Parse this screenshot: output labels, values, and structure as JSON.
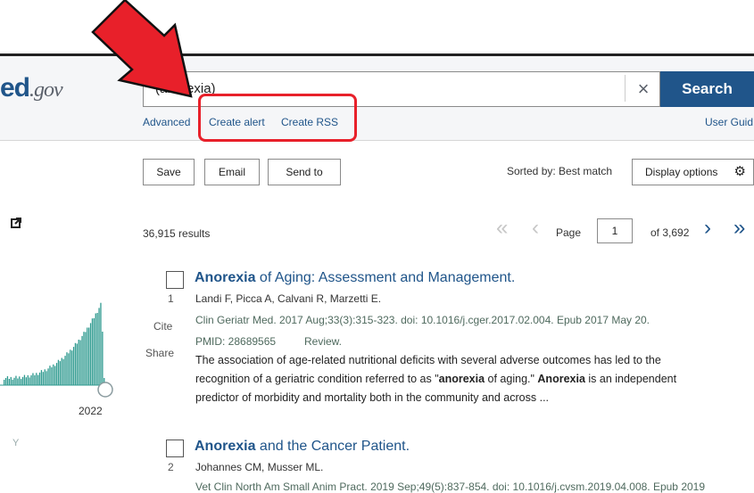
{
  "logo": {
    "text": "ed",
    "suffix": ".gov"
  },
  "search": {
    "value": "(anorexia)",
    "clear_icon": "×",
    "button_label": "Search"
  },
  "links": {
    "advanced": "Advanced",
    "create_alert": "Create alert",
    "create_rss": "Create RSS",
    "user_guide": "User Guid"
  },
  "toolbar": {
    "save": "Save",
    "email": "Email",
    "send_to": "Send to",
    "sorted_by": "Sorted by: Best match",
    "display_options": "Display options"
  },
  "results": {
    "count": "36,915 results"
  },
  "pagination": {
    "label": "Page",
    "current": "1",
    "of": "of 3,692"
  },
  "timeline": {
    "year": "2022",
    "axis_letter": "Y"
  },
  "articles": [
    {
      "number": "1",
      "title_highlight": "Anorexia",
      "title_rest": " of Aging: Assessment and Management.",
      "authors": "Landi F, Picca A, Calvani R, Marzetti E.",
      "citation": "Clin Geriatr Med. 2017 Aug;33(3):315-323. doi: 10.1016/j.cger.2017.02.004. Epub 2017 May 20.",
      "pmid": "PMID: 28689565",
      "type": "Review.",
      "cite": "Cite",
      "share": "Share",
      "snippet_1": "The association of age-related nutritional deficits with several adverse outcomes has led to the",
      "snippet_2a": "recognition of a geriatric condition referred to as \"",
      "snippet_2b": "anorexia",
      "snippet_2c": " of aging.\" ",
      "snippet_2d": "Anorexia",
      "snippet_2e": " is an independent",
      "snippet_3": "predictor of morbidity and mortality both in the community and across ..."
    },
    {
      "number": "2",
      "title_highlight": "Anorexia",
      "title_rest": " and the Cancer Patient.",
      "authors": "Johannes CM, Musser ML.",
      "citation": "Vet Clin North Am Small Anim Pract. 2019 Sep;49(5):837-854. doi: 10.1016/j.cvsm.2019.04.008. Epub 2019"
    }
  ],
  "colors": {
    "brand_blue": "#20558a",
    "highlight_red": "#e8202a",
    "bar_teal": "#2e9a8f"
  }
}
